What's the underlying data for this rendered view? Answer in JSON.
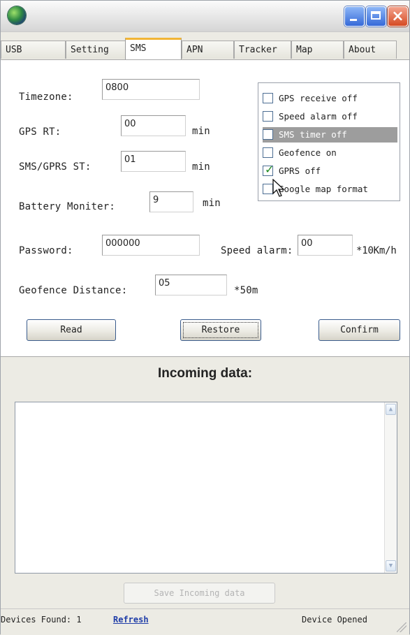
{
  "window": {
    "icon": "app-globe-icon",
    "controls": [
      "minimize-icon",
      "maximize-icon",
      "close-icon"
    ]
  },
  "tabs": [
    {
      "label": "USB"
    },
    {
      "label": "Setting"
    },
    {
      "label": "SMS",
      "active": true
    },
    {
      "label": "APN"
    },
    {
      "label": "Tracker"
    },
    {
      "label": "Map"
    },
    {
      "label": "About"
    }
  ],
  "sms": {
    "timezone_label": "Timezone:",
    "timezone_value": "0800",
    "gps_rt_label": "GPS RT:",
    "gps_rt_value": "00",
    "gps_rt_unit": "min",
    "sms_gprs_label": "SMS/GPRS ST:",
    "sms_gprs_value": "01",
    "sms_gprs_unit": "min",
    "battery_label": "Battery Moniter:",
    "battery_value": "9",
    "battery_unit": "min",
    "password_label": "Password:",
    "password_value": "000000",
    "speed_alarm_label": "Speed alarm:",
    "speed_alarm_value": "00",
    "speed_alarm_unit": "*10Km/h",
    "geofence_label": "Geofence Distance:",
    "geofence_value": "05",
    "geofence_unit": "*50m"
  },
  "options": [
    {
      "label": "GPS receive off",
      "checked": false
    },
    {
      "label": "Speed alarm off",
      "checked": false
    },
    {
      "label": "SMS timer off",
      "checked": false,
      "selected": true
    },
    {
      "label": "Geofence on",
      "checked": false
    },
    {
      "label": "GPRS off",
      "checked": true
    },
    {
      "label": "Google map format",
      "checked": false
    }
  ],
  "buttons": {
    "read": "Read",
    "restore": "Restore",
    "confirm": "Confirm",
    "save_incoming": "Save Incoming data"
  },
  "incoming": {
    "title": "Incoming data:"
  },
  "status": {
    "devices_prefix": "Devices Found: 1",
    "refresh": "Refresh",
    "device_state": "Device Opened"
  },
  "colors": {
    "active_tab": "#f1b536",
    "checkmark": "#1f8a20",
    "close_button": "#d54a23",
    "link": "#1f3da8"
  }
}
